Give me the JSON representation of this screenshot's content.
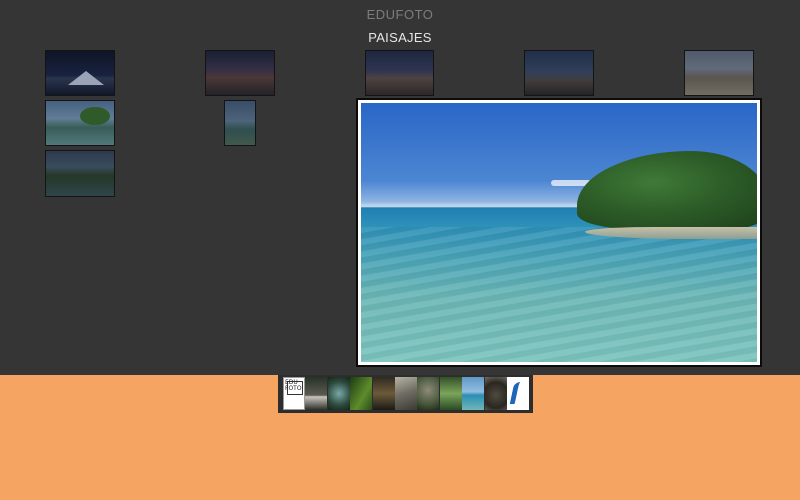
{
  "header": {
    "site_title": "EDUFOTO",
    "section_title": "PAISAJES"
  },
  "gallery": {
    "thumbnails": [
      {
        "name": "thumb-snowy-mountain-night",
        "icon": "mountain-night-image"
      },
      {
        "name": "thumb-desert-sunset",
        "icon": "desert-sunset-image"
      },
      {
        "name": "thumb-dusk-hills",
        "icon": "dusk-hills-image"
      },
      {
        "name": "thumb-rocky-coast",
        "icon": "rocky-coast-image"
      },
      {
        "name": "thumb-beach-shore",
        "icon": "beach-shore-image"
      },
      {
        "name": "thumb-mangrove-island",
        "icon": "mangrove-island-image"
      },
      {
        "name": "thumb-tall-coast",
        "icon": "coast-image"
      },
      {
        "name": "thumb-lagoon-forest",
        "icon": "lagoon-forest-image"
      }
    ],
    "selected": "thumb-mangrove-island"
  },
  "viewer": {
    "image": "mangrove-island-seascape"
  },
  "filmstrip": {
    "logo_label": "EDU FOTO",
    "items": [
      "edufoto-logo",
      "bird",
      "eye-plant",
      "green-leaf",
      "insect",
      "wolf",
      "bird-branch",
      "green-foliage",
      "beach",
      "iguana",
      "blue-swoosh-logo"
    ]
  },
  "colors": {
    "background_dark": "#353535",
    "background_orange": "#f5a461",
    "title_gray": "#7d7d7d",
    "section_white": "#e6e6e6"
  }
}
